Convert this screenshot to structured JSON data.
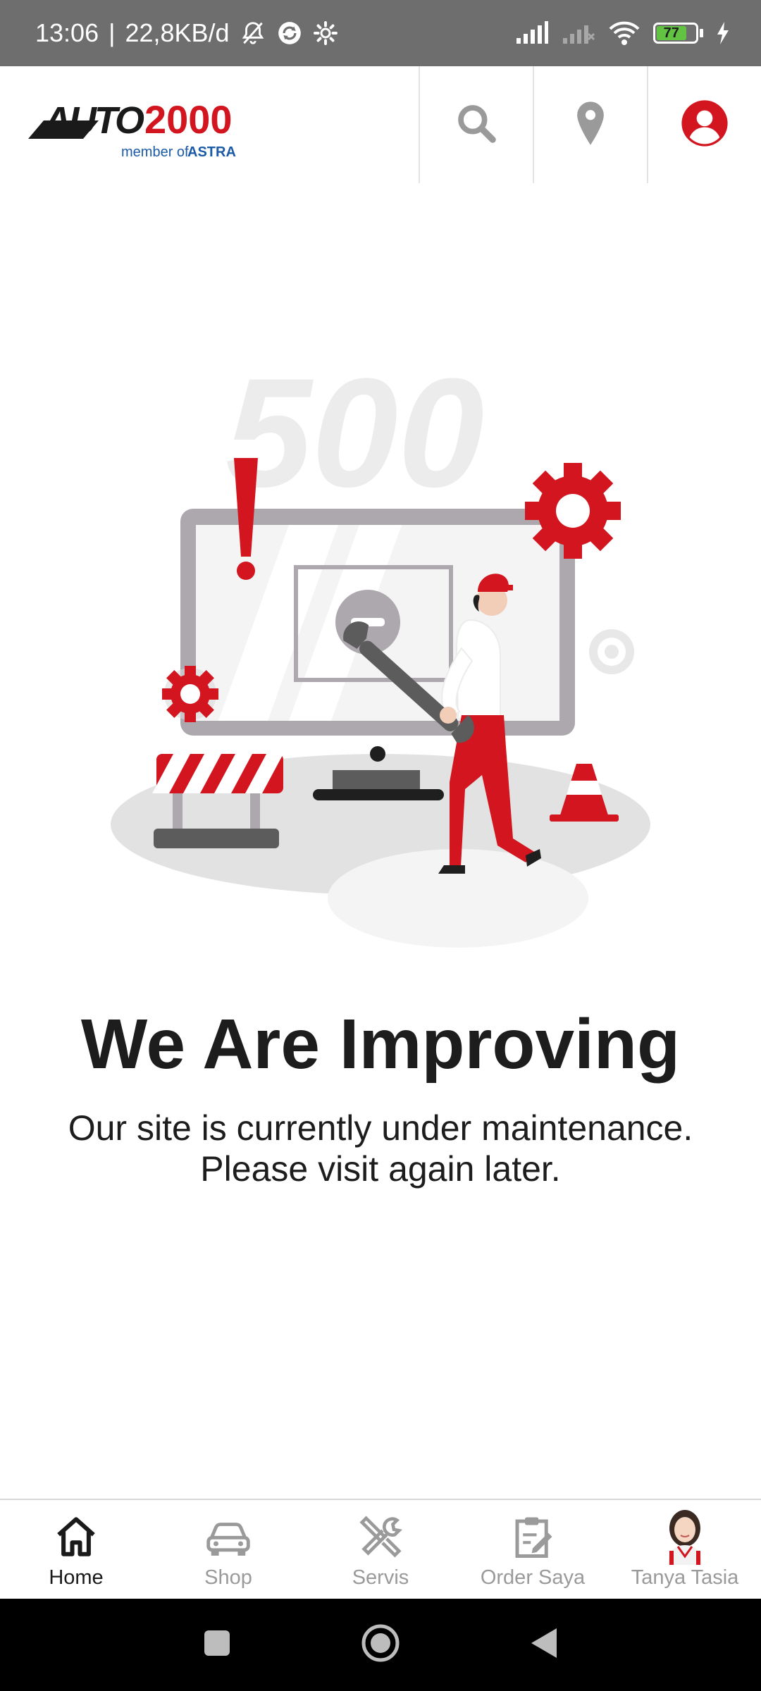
{
  "status_bar": {
    "time": "13:06",
    "separator": "|",
    "speed": "22,8KB/d",
    "battery_level": "77"
  },
  "header": {
    "brand": "AUTO 2000",
    "tagline_prefix": "member of",
    "tagline_brand": "ASTRA"
  },
  "illustration": {
    "code": "500"
  },
  "main": {
    "title": "We Are Improving",
    "line1": "Our site is currently under maintenance.",
    "line2": "Please visit again later."
  },
  "bottom_nav": {
    "items": [
      {
        "label": "Home",
        "icon": "home-icon",
        "active": true
      },
      {
        "label": "Shop",
        "icon": "car-icon",
        "active": false
      },
      {
        "label": "Servis",
        "icon": "tools-icon",
        "active": false
      },
      {
        "label": "Order Saya",
        "icon": "clipboard-icon",
        "active": false
      },
      {
        "label": "Tanya Tasia",
        "icon": "assistant-avatar-icon",
        "active": false
      }
    ]
  },
  "colors": {
    "brand_red": "#d2151e",
    "astra_blue": "#1b5aa6",
    "status_bar": "#6e6e6e",
    "gray_icon": "#9a9a9a"
  }
}
